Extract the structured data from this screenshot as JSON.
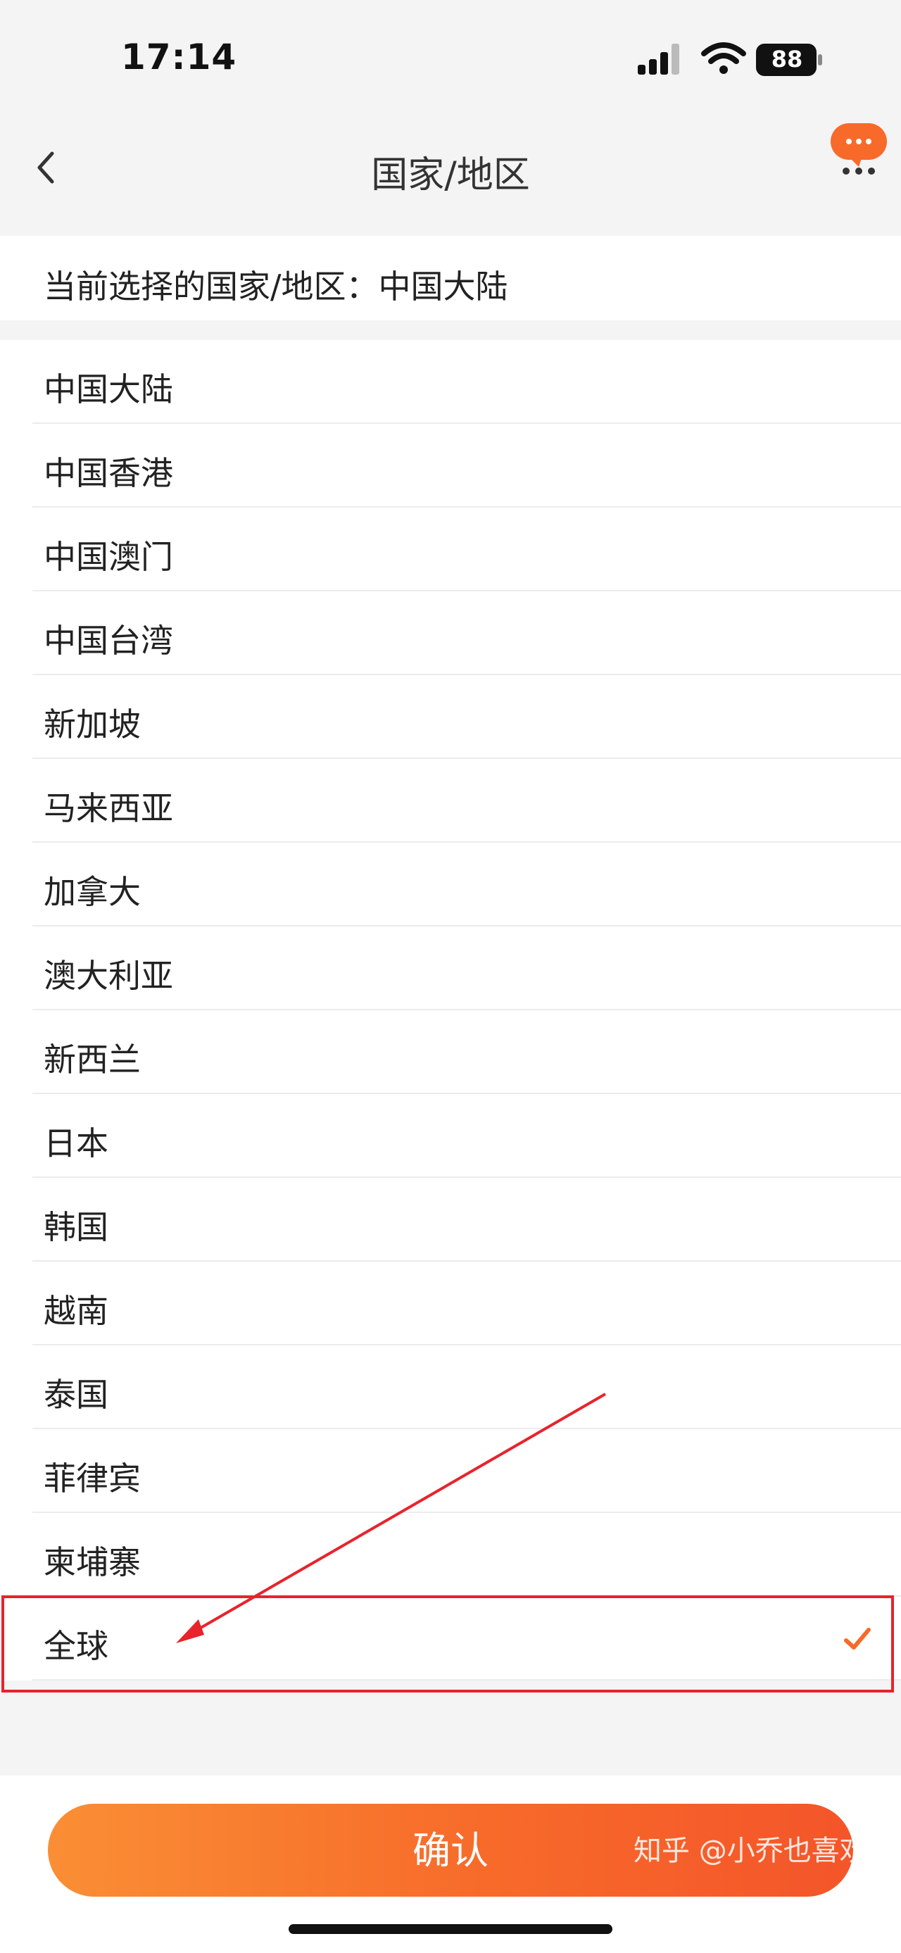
{
  "status_bar": {
    "time": "17:14",
    "battery": "88"
  },
  "nav": {
    "title": "国家/地区"
  },
  "current": {
    "text": "当前选择的国家/地区：中国大陆"
  },
  "regions": [
    {
      "label": "中国大陆",
      "selected": false
    },
    {
      "label": "中国香港",
      "selected": false
    },
    {
      "label": "中国澳门",
      "selected": false
    },
    {
      "label": "中国台湾",
      "selected": false
    },
    {
      "label": "新加坡",
      "selected": false
    },
    {
      "label": "马来西亚",
      "selected": false
    },
    {
      "label": "加拿大",
      "selected": false
    },
    {
      "label": "澳大利亚",
      "selected": false
    },
    {
      "label": "新西兰",
      "selected": false
    },
    {
      "label": "日本",
      "selected": false
    },
    {
      "label": "韩国",
      "selected": false
    },
    {
      "label": "越南",
      "selected": false
    },
    {
      "label": "泰国",
      "selected": false
    },
    {
      "label": "菲律宾",
      "selected": false
    },
    {
      "label": "柬埔寨",
      "selected": false
    },
    {
      "label": "全球",
      "selected": true
    }
  ],
  "footer": {
    "confirm_label": "确认",
    "watermark": "知乎 @小乔也喜欢你"
  },
  "colors": {
    "accent": "#f76a2a",
    "annotation": "#e8232c",
    "chat_icon": "#f86a2a"
  },
  "icons": {
    "back": "chevron-left-icon",
    "more": "chat-more-icon",
    "check": "check-icon"
  }
}
